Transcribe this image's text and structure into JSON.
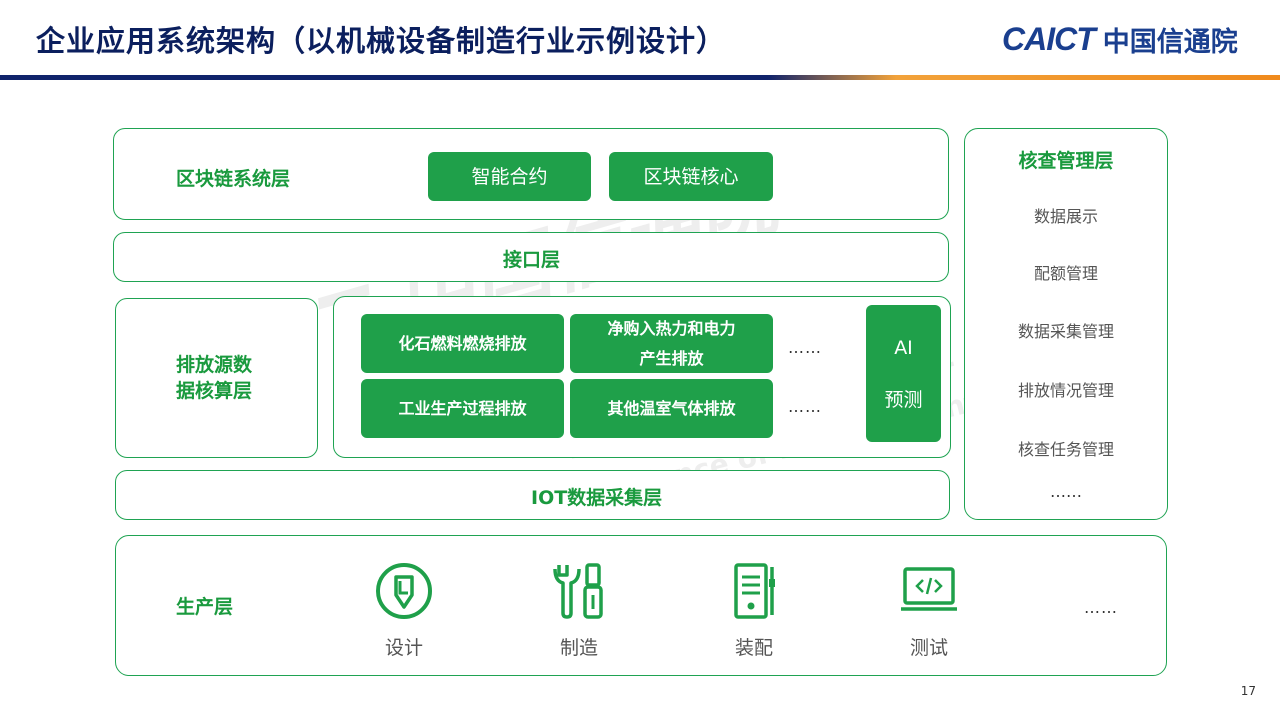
{
  "header": {
    "title": "企业应用系统架构（以机械设备制造行业示例设计）",
    "logo_abbr": "CAICT",
    "logo_name": "中国信通院"
  },
  "blockchain_layer": {
    "label": "区块链系统层",
    "items": [
      "智能合约",
      "区块链核心"
    ]
  },
  "interface_layer": {
    "label": "接口层"
  },
  "emission_layer": {
    "label_line1": "排放源数",
    "label_line2": "据核算层",
    "items": [
      {
        "line1": "化石燃料燃烧排放",
        "line2": ""
      },
      {
        "line1": "净购入热力和电力",
        "line2": "产生排放"
      },
      {
        "line1": "工业生产过程排放",
        "line2": ""
      },
      {
        "line1": "其他温室气体排放",
        "line2": ""
      }
    ],
    "more_top": "……",
    "more_bottom": "……",
    "ai_line1": "AI",
    "ai_line2": "预测"
  },
  "iot_layer": {
    "label": "IOT数据采集层"
  },
  "audit_layer": {
    "title": "核查管理层",
    "items": [
      "数据展示",
      "配额管理",
      "数据采集管理",
      "排放情况管理",
      "核查任务管理",
      "……"
    ]
  },
  "production_layer": {
    "label": "生产层",
    "items": [
      {
        "label": "设计",
        "icon": "pen-badge-icon"
      },
      {
        "label": "制造",
        "icon": "wrench-screwdriver-icon"
      },
      {
        "label": "装配",
        "icon": "document-list-icon"
      },
      {
        "label": "测试",
        "icon": "code-monitor-icon"
      }
    ],
    "more": "……"
  },
  "colors": {
    "accent_green": "#1fa04a",
    "label_green": "#1a9a3e",
    "title_navy": "#0b1f5e",
    "bar_orange": "#f08a1c"
  },
  "page_number": "17"
}
